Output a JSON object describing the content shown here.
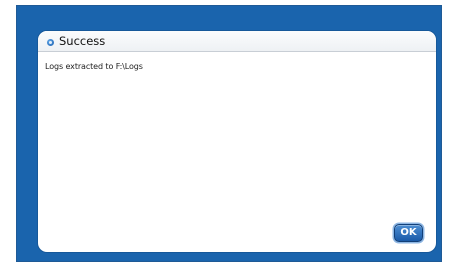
{
  "dialog": {
    "title": "Success",
    "title_icon": "info-dot-icon",
    "message": "Logs extracted to F:\\Logs",
    "ok_label": "OK"
  },
  "colors": {
    "background": "#1a64ad",
    "button": "#1f62b0"
  }
}
